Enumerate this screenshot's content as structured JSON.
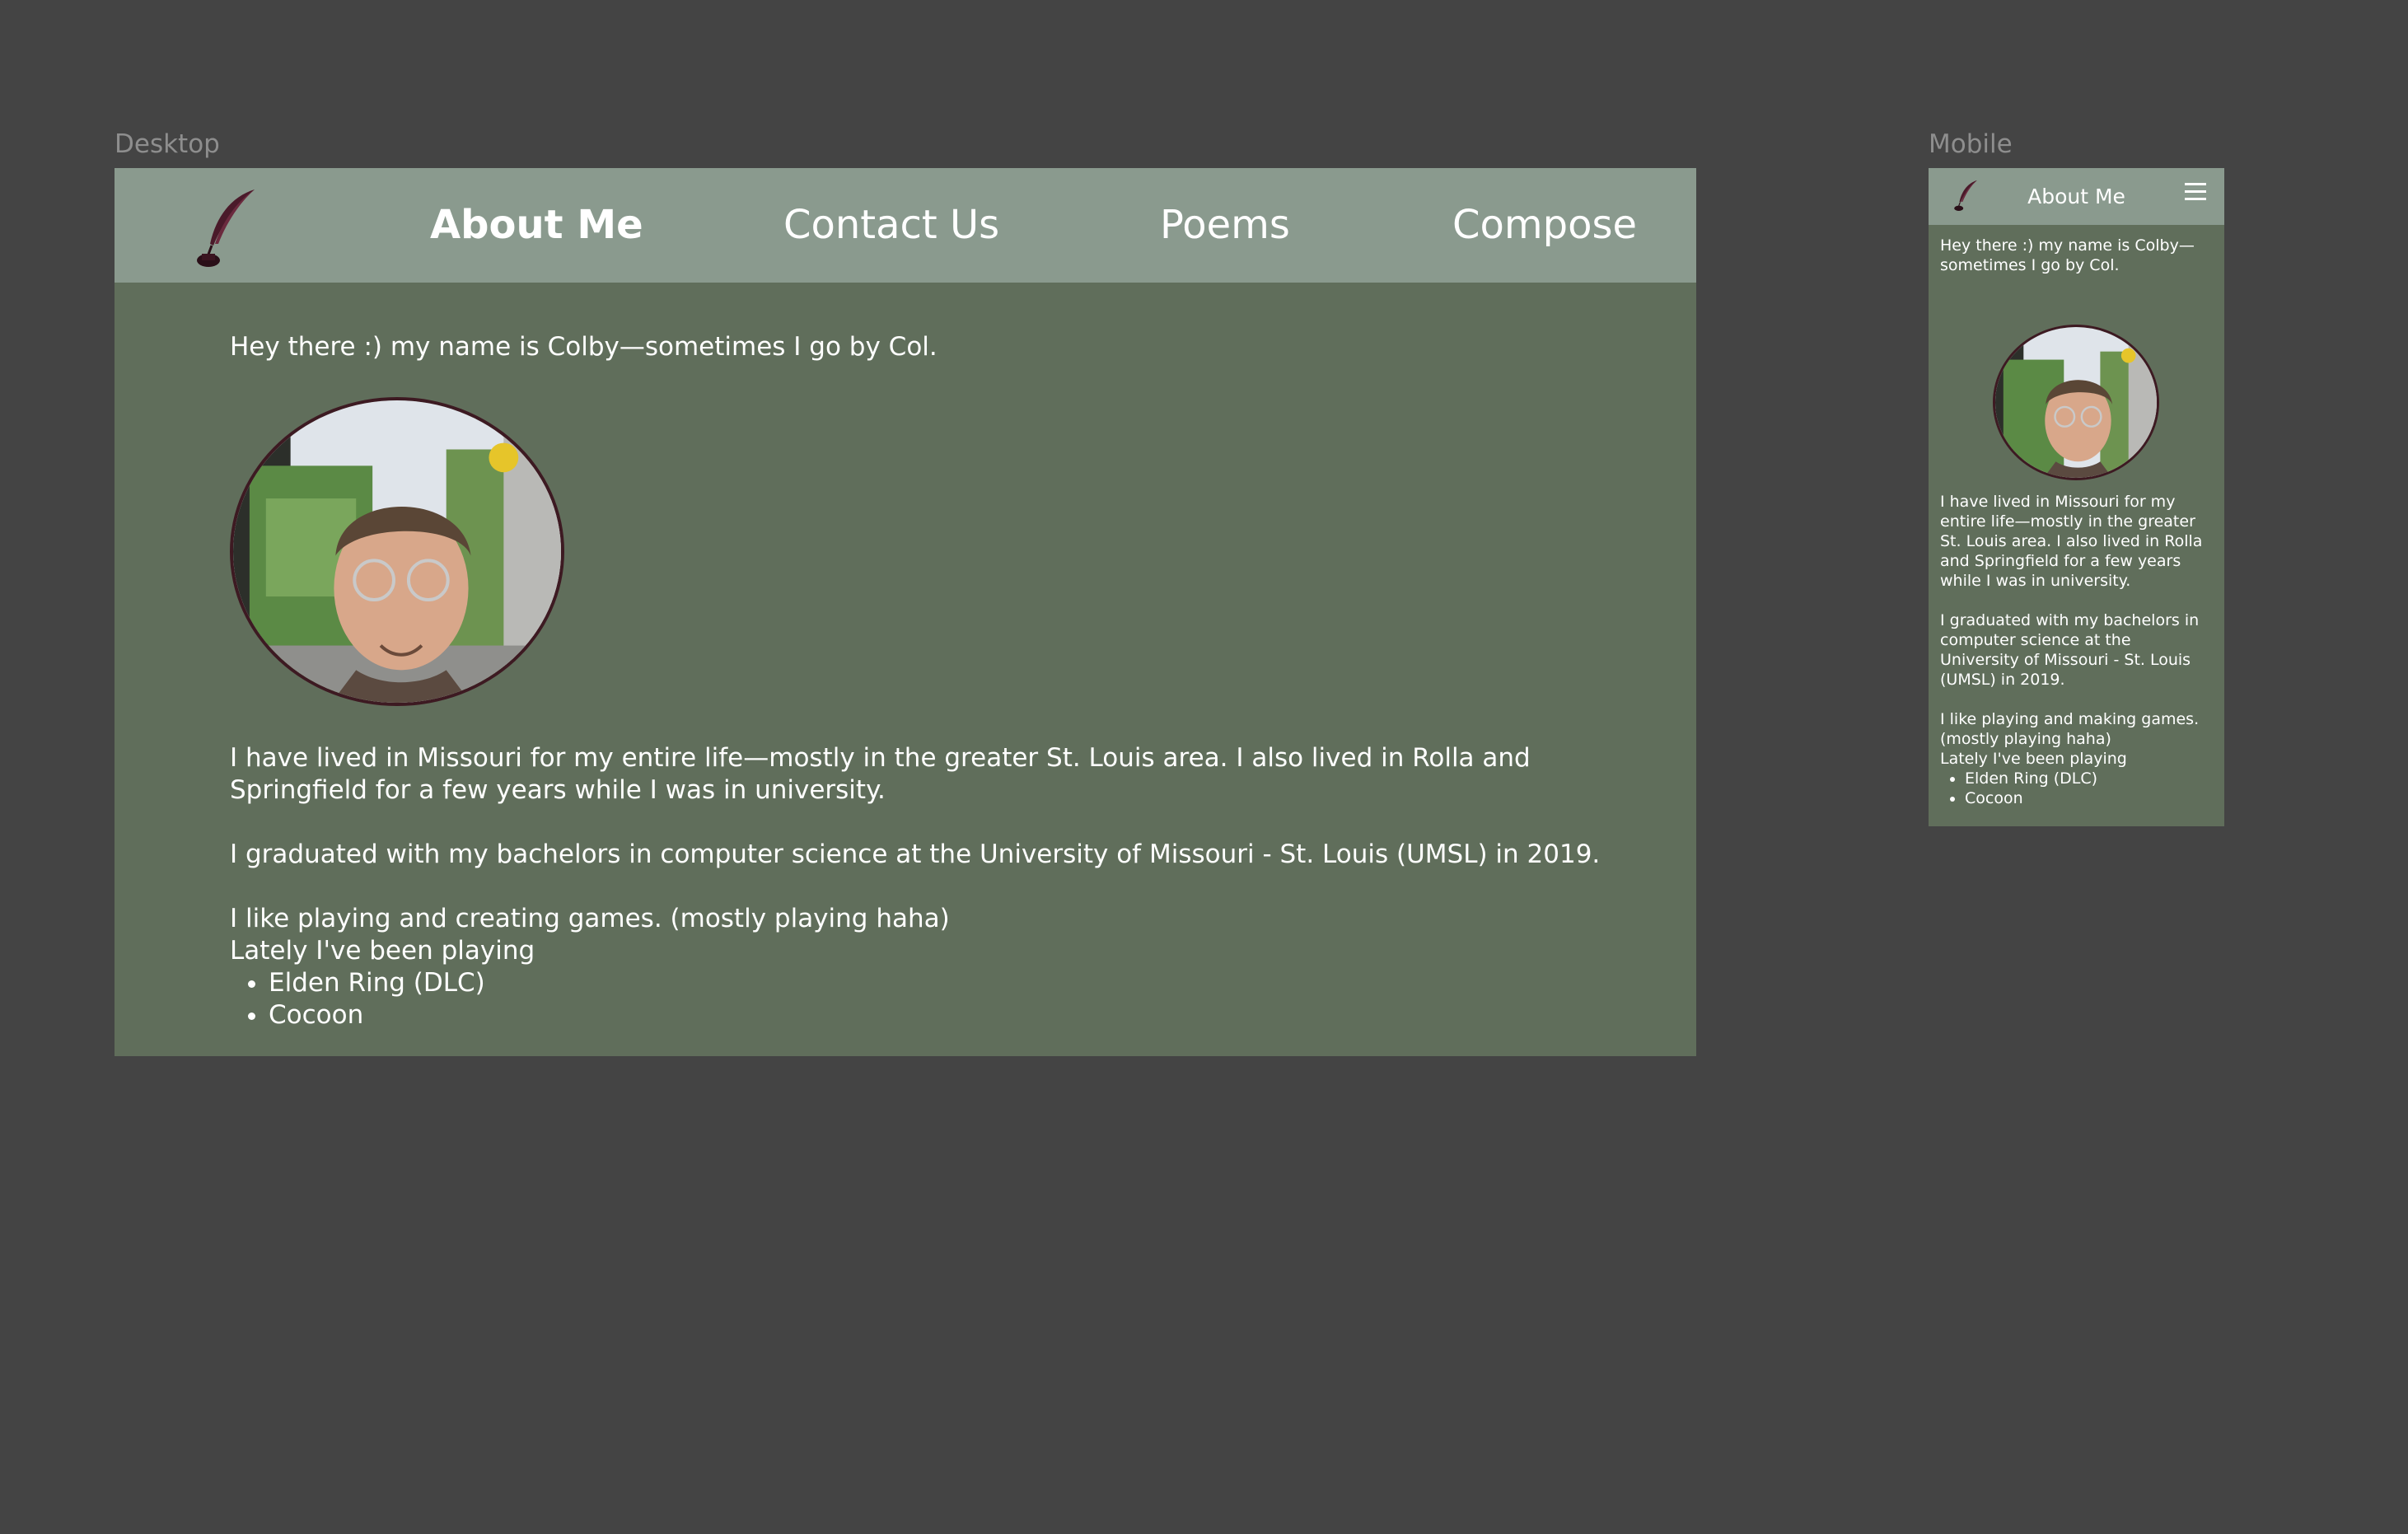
{
  "frames": {
    "desktop_label": "Desktop",
    "mobile_label": "Mobile"
  },
  "nav": {
    "about": "About Me",
    "contact": "Contact Us",
    "poems": "Poems",
    "compose": "Compose"
  },
  "content": {
    "greeting_desktop": "Hey there :) my name is Colby—sometimes I go by Col.",
    "history": "I have lived in Missouri for my entire life—mostly in the greater St. Louis area. I also lived in Rolla and Springfield for a few years while I was in university.",
    "education": "I graduated with my bachelors in computer science at the University of Missouri - St. Louis (UMSL) in 2019.",
    "games_intro_desktop": "I like playing and creating games. (mostly playing haha)",
    "lately": "Lately I've been playing",
    "games": [
      "Elden Ring (DLC)",
      "Cocoon"
    ]
  },
  "mobile": {
    "title": "About Me",
    "greeting": "Hey there :) my name is Colby—sometimes I go by Col.",
    "games_intro": "I like playing and making games. (mostly playing haha)"
  },
  "icons": {
    "logo": "quill-inkwell-icon",
    "menu": "hamburger-menu-icon"
  },
  "colors": {
    "background": "#444444",
    "nav": "#8a9a8e",
    "content": "#606e5b",
    "text": "#ffffff",
    "quill": "#4a1a2a"
  }
}
